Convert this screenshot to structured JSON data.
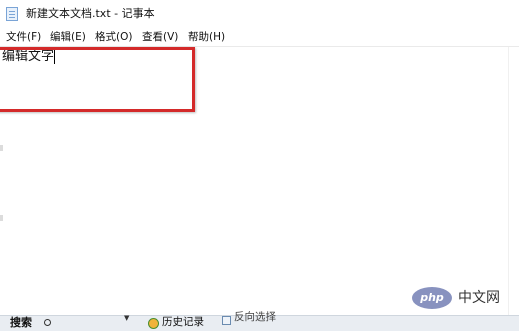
{
  "window": {
    "title": "新建文本文档.txt - 记事本",
    "app_icon": "notepad-icon"
  },
  "menu": {
    "items": [
      "文件(F)",
      "编辑(E)",
      "格式(O)",
      "查看(V)",
      "帮助(H)"
    ]
  },
  "editor": {
    "content": "编辑文字"
  },
  "annotation": {
    "color": "#d42a2a"
  },
  "taskbar": {
    "search_label": "搜索",
    "history_label": "历史记录",
    "reverse_label": "反向选择"
  },
  "watermark": {
    "logo_text": "php",
    "site_text": "中文网"
  }
}
